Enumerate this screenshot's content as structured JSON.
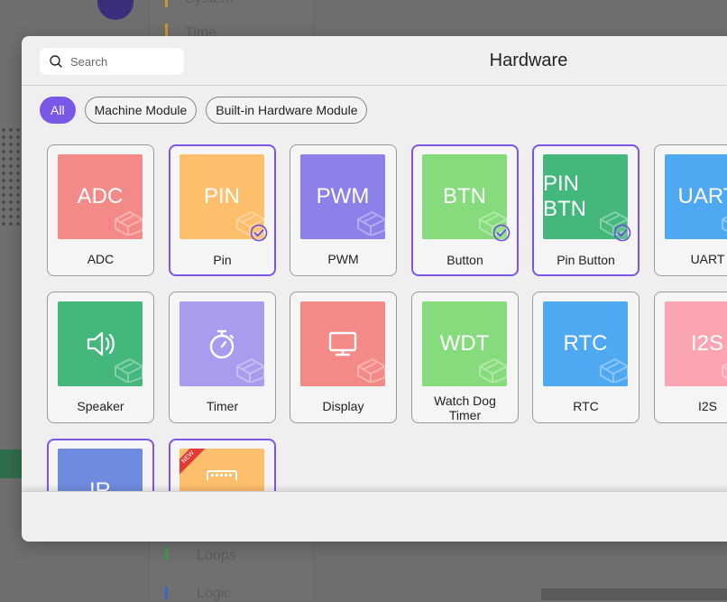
{
  "background": {
    "menu_items": [
      "System",
      "Time",
      "Loops",
      "Logic"
    ]
  },
  "modal": {
    "title": "Hardware",
    "search": {
      "placeholder": "Search",
      "value": ""
    },
    "filters": [
      {
        "label": "All",
        "active": true
      },
      {
        "label": "Machine Module",
        "active": false
      },
      {
        "label": "Built-in Hardware Module",
        "active": false
      }
    ],
    "cards": [
      {
        "tile_text": "ADC",
        "label": "ADC",
        "color": "#f48a87",
        "selected": false
      },
      {
        "tile_text": "PIN",
        "label": "Pin",
        "color": "#fdbf6b",
        "selected": true
      },
      {
        "tile_text": "PWM",
        "label": "PWM",
        "color": "#8c80e9",
        "selected": false
      },
      {
        "tile_text": "BTN",
        "label": "Button",
        "color": "#86dc7d",
        "selected": true
      },
      {
        "tile_text": "PIN BTN",
        "label": "Pin Button",
        "color": "#43b77c",
        "selected": true
      },
      {
        "tile_text": "UART",
        "label": "UART",
        "color": "#4ea8f2",
        "selected": false
      },
      {
        "icon": "speaker-icon",
        "label": "Speaker",
        "color": "#43b77c",
        "selected": false
      },
      {
        "icon": "stopwatch-icon",
        "label": "Timer",
        "color": "#a99bee",
        "selected": false
      },
      {
        "icon": "monitor-icon",
        "label": "Display",
        "color": "#f48a87",
        "selected": false
      },
      {
        "tile_text": "WDT",
        "label": "Watch Dog Timer",
        "color": "#86dc7d",
        "selected": false
      },
      {
        "tile_text": "RTC",
        "label": "RTC",
        "color": "#4ea8f2",
        "selected": false
      },
      {
        "tile_text": "I2S",
        "label": "I2S",
        "color": "#fba5b3",
        "selected": false
      },
      {
        "tile_text": "IR",
        "label": "",
        "color": "#6f8be0",
        "selected": true
      },
      {
        "icon": "keyboard-icon",
        "label": "",
        "color": "#fdbf6b",
        "selected": true,
        "badge": "NEW"
      }
    ]
  }
}
